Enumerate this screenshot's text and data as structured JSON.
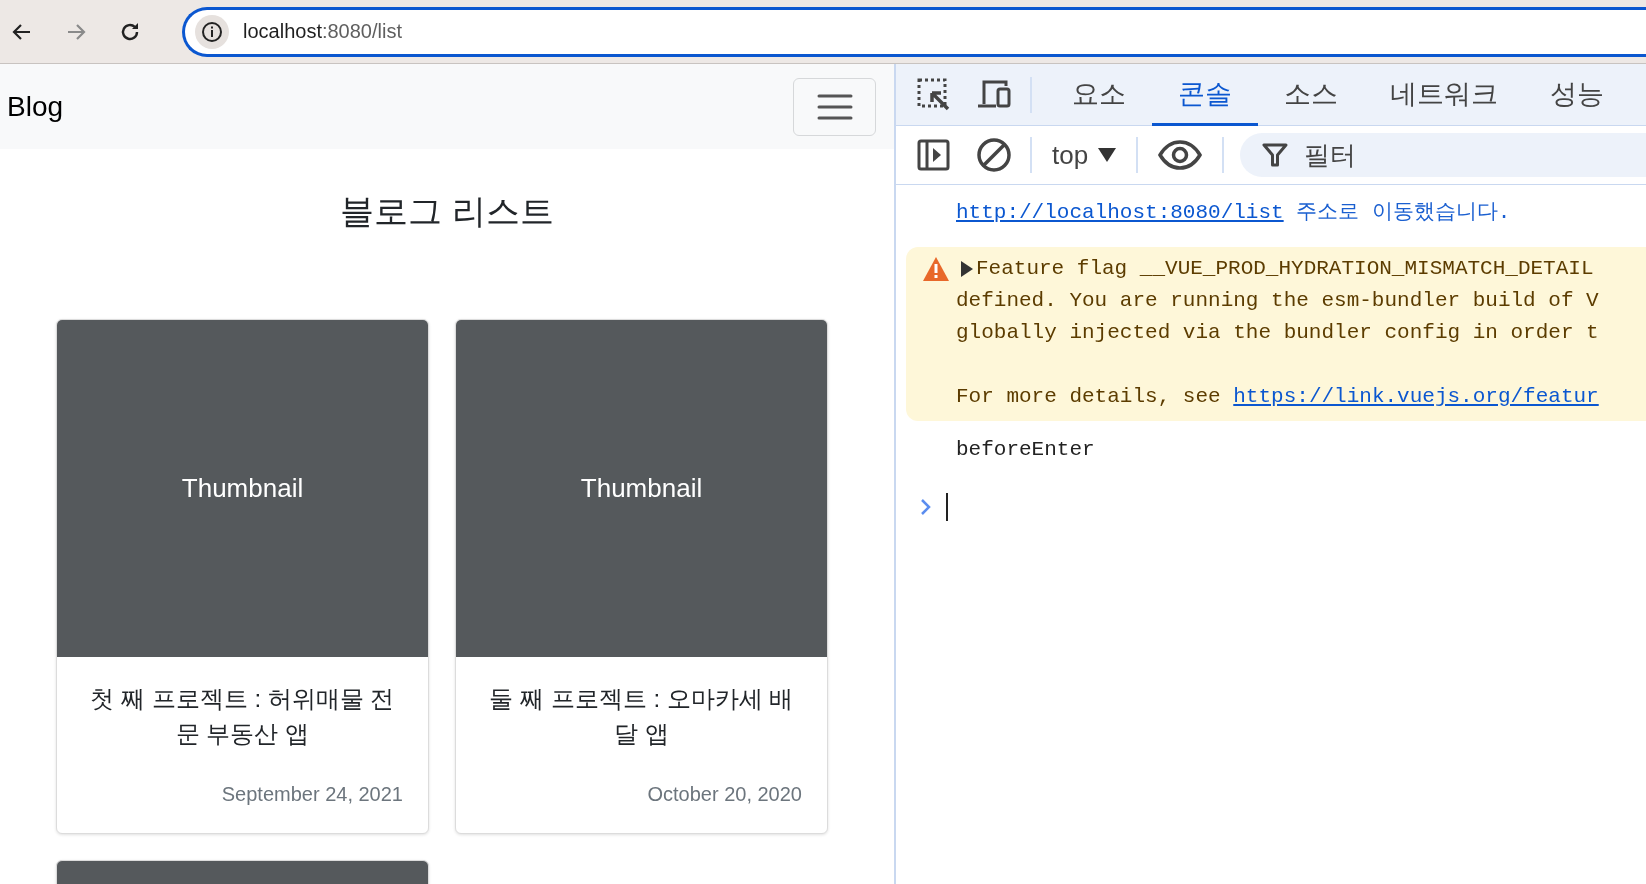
{
  "browser": {
    "url_host": "localhost",
    "url_path": ":8080/list"
  },
  "page": {
    "brand": "Blog",
    "heading": "블로그 리스트",
    "cards": [
      {
        "cut_off": false,
        "thumbnail": "Thumbnail",
        "title": "첫 째 프로젝트 : 허위매물 전문 부동산 앱",
        "date": "September 24, 2021"
      },
      {
        "cut_off": false,
        "thumbnail": "Thumbnail",
        "title": "둘 째 프로젝트 : 오마카세 배달 앱",
        "date": "October 20, 2020"
      },
      {
        "cut_off": true
      }
    ]
  },
  "devtools": {
    "tabs": [
      {
        "label": "요소",
        "selected": false
      },
      {
        "label": "콘솔",
        "selected": true
      },
      {
        "label": "소스",
        "selected": false
      },
      {
        "label": "네트워크",
        "selected": false
      },
      {
        "label": "성능",
        "selected": false
      }
    ],
    "context": "top",
    "filter_placeholder": "필터",
    "messages": [
      {
        "kind": "navigation",
        "link": "http://localhost:8080/list",
        "text": "주소로 이동했습니다."
      },
      {
        "kind": "warning",
        "expanded": false,
        "summary": "Feature flag __VUE_PROD_HYDRATION_MISMATCH_DETAIL",
        "body": [
          "defined. You are running the esm-bundler build of V",
          "globally injected via the bundler config in order t"
        ],
        "details_text": "For more details, see",
        "details_link": "https://link.vuejs.org/featur"
      },
      {
        "kind": "log",
        "text": "beforeEnter"
      }
    ]
  }
}
